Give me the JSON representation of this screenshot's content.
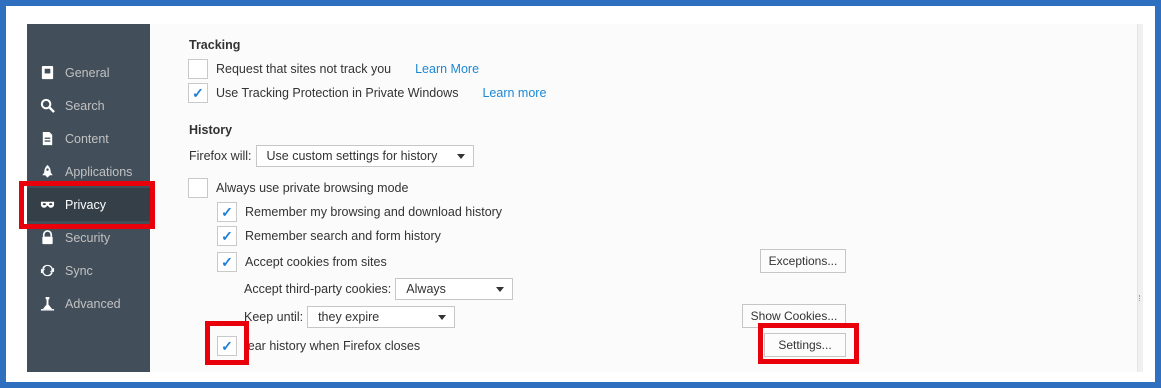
{
  "sidebar": {
    "items": [
      {
        "label": "General",
        "icon": "general-icon"
      },
      {
        "label": "Search",
        "icon": "search-icon"
      },
      {
        "label": "Content",
        "icon": "content-icon"
      },
      {
        "label": "Applications",
        "icon": "applications-icon"
      },
      {
        "label": "Privacy",
        "icon": "privacy-mask-icon",
        "selected": true
      },
      {
        "label": "Security",
        "icon": "security-icon"
      },
      {
        "label": "Sync",
        "icon": "sync-icon"
      },
      {
        "label": "Advanced",
        "icon": "advanced-icon"
      }
    ]
  },
  "tracking": {
    "heading": "Tracking",
    "do_not_track_label": "Request that sites not track you",
    "do_not_track_checked": false,
    "do_not_track_link": "Learn More",
    "tracking_protection_label": "Use Tracking Protection in Private Windows",
    "tracking_protection_checked": true,
    "tracking_protection_link": "Learn more"
  },
  "history": {
    "heading": "History",
    "firefox_will_label": "Firefox will:",
    "firefox_will_value": "Use custom settings for history",
    "private_mode_label": "Always use private browsing mode",
    "remember_browsing_label": "Remember my browsing and download history",
    "remember_search_label": "Remember search and form history",
    "accept_cookies_label": "Accept cookies from sites",
    "exceptions_button": "Exceptions...",
    "third_party_label": "Accept third-party cookies:",
    "third_party_value": "Always",
    "keep_until_label": "Keep until:",
    "keep_until_value": "they expire",
    "show_cookies_button": "Show Cookies...",
    "clear_history_label": "lear history when Firefox closes",
    "settings_button": "Settings..."
  },
  "colors": {
    "frame": "#2e6fbf",
    "highlight": "#e8000a",
    "sidebar": "#424f5a",
    "link": "#1c88d4"
  }
}
